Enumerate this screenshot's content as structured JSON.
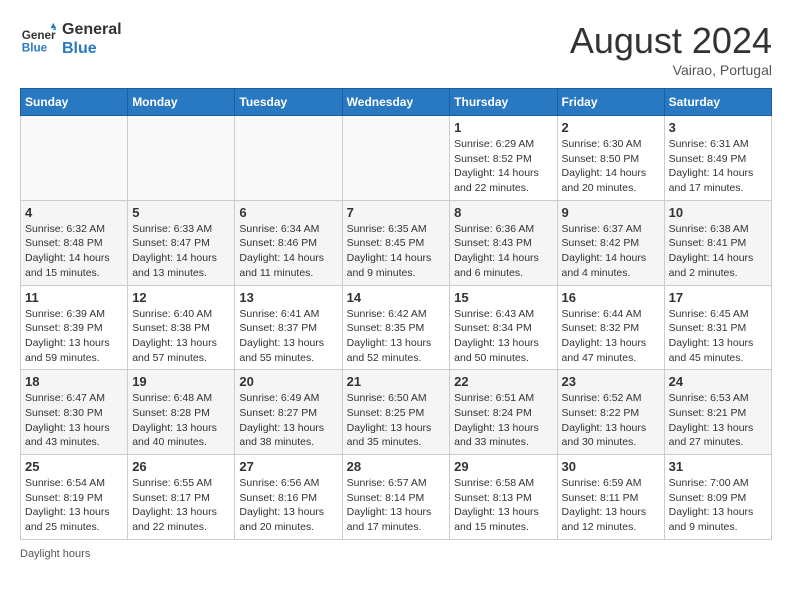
{
  "header": {
    "logo_line1": "General",
    "logo_line2": "Blue",
    "month_year": "August 2024",
    "location": "Vairao, Portugal"
  },
  "weekdays": [
    "Sunday",
    "Monday",
    "Tuesday",
    "Wednesday",
    "Thursday",
    "Friday",
    "Saturday"
  ],
  "weeks": [
    [
      {
        "day": "",
        "info": ""
      },
      {
        "day": "",
        "info": ""
      },
      {
        "day": "",
        "info": ""
      },
      {
        "day": "",
        "info": ""
      },
      {
        "day": "1",
        "info": "Sunrise: 6:29 AM\nSunset: 8:52 PM\nDaylight: 14 hours and 22 minutes."
      },
      {
        "day": "2",
        "info": "Sunrise: 6:30 AM\nSunset: 8:50 PM\nDaylight: 14 hours and 20 minutes."
      },
      {
        "day": "3",
        "info": "Sunrise: 6:31 AM\nSunset: 8:49 PM\nDaylight: 14 hours and 17 minutes."
      }
    ],
    [
      {
        "day": "4",
        "info": "Sunrise: 6:32 AM\nSunset: 8:48 PM\nDaylight: 14 hours and 15 minutes."
      },
      {
        "day": "5",
        "info": "Sunrise: 6:33 AM\nSunset: 8:47 PM\nDaylight: 14 hours and 13 minutes."
      },
      {
        "day": "6",
        "info": "Sunrise: 6:34 AM\nSunset: 8:46 PM\nDaylight: 14 hours and 11 minutes."
      },
      {
        "day": "7",
        "info": "Sunrise: 6:35 AM\nSunset: 8:45 PM\nDaylight: 14 hours and 9 minutes."
      },
      {
        "day": "8",
        "info": "Sunrise: 6:36 AM\nSunset: 8:43 PM\nDaylight: 14 hours and 6 minutes."
      },
      {
        "day": "9",
        "info": "Sunrise: 6:37 AM\nSunset: 8:42 PM\nDaylight: 14 hours and 4 minutes."
      },
      {
        "day": "10",
        "info": "Sunrise: 6:38 AM\nSunset: 8:41 PM\nDaylight: 14 hours and 2 minutes."
      }
    ],
    [
      {
        "day": "11",
        "info": "Sunrise: 6:39 AM\nSunset: 8:39 PM\nDaylight: 13 hours and 59 minutes."
      },
      {
        "day": "12",
        "info": "Sunrise: 6:40 AM\nSunset: 8:38 PM\nDaylight: 13 hours and 57 minutes."
      },
      {
        "day": "13",
        "info": "Sunrise: 6:41 AM\nSunset: 8:37 PM\nDaylight: 13 hours and 55 minutes."
      },
      {
        "day": "14",
        "info": "Sunrise: 6:42 AM\nSunset: 8:35 PM\nDaylight: 13 hours and 52 minutes."
      },
      {
        "day": "15",
        "info": "Sunrise: 6:43 AM\nSunset: 8:34 PM\nDaylight: 13 hours and 50 minutes."
      },
      {
        "day": "16",
        "info": "Sunrise: 6:44 AM\nSunset: 8:32 PM\nDaylight: 13 hours and 47 minutes."
      },
      {
        "day": "17",
        "info": "Sunrise: 6:45 AM\nSunset: 8:31 PM\nDaylight: 13 hours and 45 minutes."
      }
    ],
    [
      {
        "day": "18",
        "info": "Sunrise: 6:47 AM\nSunset: 8:30 PM\nDaylight: 13 hours and 43 minutes."
      },
      {
        "day": "19",
        "info": "Sunrise: 6:48 AM\nSunset: 8:28 PM\nDaylight: 13 hours and 40 minutes."
      },
      {
        "day": "20",
        "info": "Sunrise: 6:49 AM\nSunset: 8:27 PM\nDaylight: 13 hours and 38 minutes."
      },
      {
        "day": "21",
        "info": "Sunrise: 6:50 AM\nSunset: 8:25 PM\nDaylight: 13 hours and 35 minutes."
      },
      {
        "day": "22",
        "info": "Sunrise: 6:51 AM\nSunset: 8:24 PM\nDaylight: 13 hours and 33 minutes."
      },
      {
        "day": "23",
        "info": "Sunrise: 6:52 AM\nSunset: 8:22 PM\nDaylight: 13 hours and 30 minutes."
      },
      {
        "day": "24",
        "info": "Sunrise: 6:53 AM\nSunset: 8:21 PM\nDaylight: 13 hours and 27 minutes."
      }
    ],
    [
      {
        "day": "25",
        "info": "Sunrise: 6:54 AM\nSunset: 8:19 PM\nDaylight: 13 hours and 25 minutes."
      },
      {
        "day": "26",
        "info": "Sunrise: 6:55 AM\nSunset: 8:17 PM\nDaylight: 13 hours and 22 minutes."
      },
      {
        "day": "27",
        "info": "Sunrise: 6:56 AM\nSunset: 8:16 PM\nDaylight: 13 hours and 20 minutes."
      },
      {
        "day": "28",
        "info": "Sunrise: 6:57 AM\nSunset: 8:14 PM\nDaylight: 13 hours and 17 minutes."
      },
      {
        "day": "29",
        "info": "Sunrise: 6:58 AM\nSunset: 8:13 PM\nDaylight: 13 hours and 15 minutes."
      },
      {
        "day": "30",
        "info": "Sunrise: 6:59 AM\nSunset: 8:11 PM\nDaylight: 13 hours and 12 minutes."
      },
      {
        "day": "31",
        "info": "Sunrise: 7:00 AM\nSunset: 8:09 PM\nDaylight: 13 hours and 9 minutes."
      }
    ]
  ],
  "footer": "Daylight hours"
}
